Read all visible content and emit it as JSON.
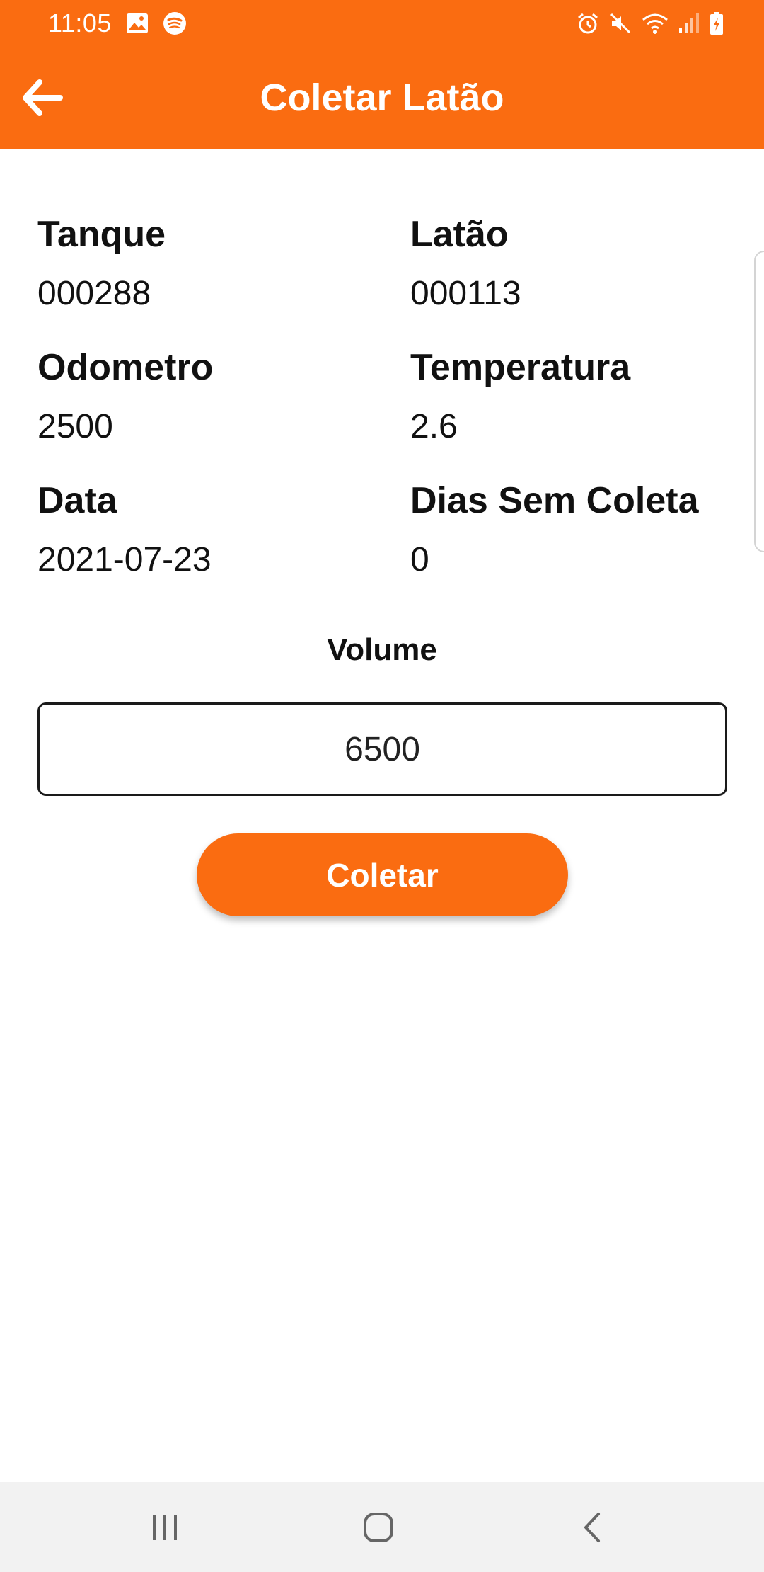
{
  "status_bar": {
    "time": "11:05",
    "icons_left": [
      "gallery-icon",
      "spotify-icon"
    ],
    "icons_right": [
      "alarm-icon",
      "mute-icon",
      "wifi-icon",
      "signal-icon",
      "battery-charging-icon"
    ]
  },
  "app_bar": {
    "title": "Coletar Latão",
    "back_icon": "arrow-left-icon"
  },
  "info": {
    "tanque": {
      "label": "Tanque",
      "value": "000288"
    },
    "latao": {
      "label": "Latão",
      "value": "000113"
    },
    "odometro": {
      "label": "Odometro",
      "value": "2500"
    },
    "temperatura": {
      "label": "Temperatura",
      "value": "2.6"
    },
    "data": {
      "label": "Data",
      "value": "2021-07-23"
    },
    "dias": {
      "label": "Dias Sem Coleta",
      "value": "0"
    }
  },
  "volume": {
    "label": "Volume",
    "value": "6500"
  },
  "actions": {
    "collect_label": "Coletar"
  },
  "nav_bar": {
    "icons": [
      "recent-apps-icon",
      "home-icon",
      "back-icon"
    ]
  },
  "colors": {
    "brand": "#fa6c11",
    "nav_background": "#f2f2f2",
    "text": "#111111"
  }
}
